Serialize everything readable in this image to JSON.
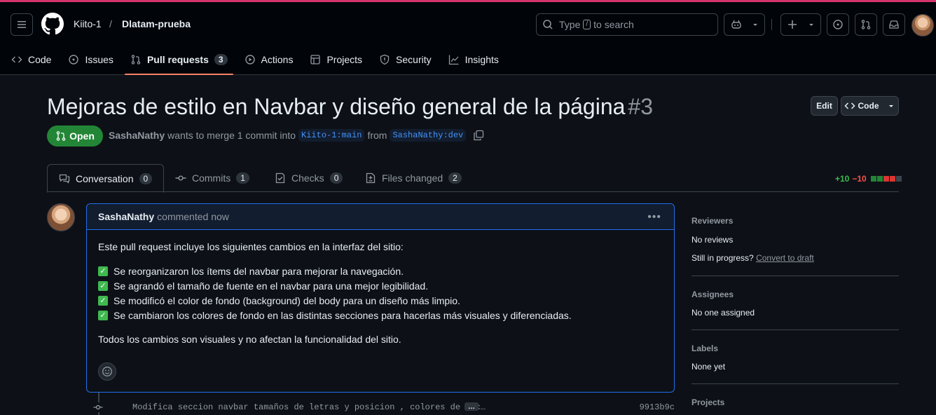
{
  "header": {
    "owner": "Kiito-1",
    "separator": "/",
    "repo": "Dlatam-prueba",
    "search": {
      "prefix": "Type",
      "key": "/",
      "suffix": "to search"
    }
  },
  "nav": {
    "items": [
      {
        "label": "Code",
        "icon": "code-icon"
      },
      {
        "label": "Issues",
        "icon": "issue-icon"
      },
      {
        "label": "Pull requests",
        "icon": "pull-request-icon",
        "count": "3",
        "active": true
      },
      {
        "label": "Actions",
        "icon": "play-icon"
      },
      {
        "label": "Projects",
        "icon": "table-icon"
      },
      {
        "label": "Security",
        "icon": "shield-icon"
      },
      {
        "label": "Insights",
        "icon": "graph-icon"
      }
    ]
  },
  "pr": {
    "title": "Mejoras de estilo en Navbar y diseño general de la página",
    "number": "#3",
    "edit_label": "Edit",
    "code_label": "Code",
    "state": "Open",
    "author": "SashaNathy",
    "merge_text": "wants to merge 1 commit into",
    "base_branch": "Kiito-1:main",
    "from_text": "from",
    "head_branch": "SashaNathy:dev"
  },
  "tabs": [
    {
      "label": "Conversation",
      "count": "0"
    },
    {
      "label": "Commits",
      "count": "1"
    },
    {
      "label": "Checks",
      "count": "0"
    },
    {
      "label": "Files changed",
      "count": "2"
    }
  ],
  "diffstat": {
    "additions": "+10",
    "deletions": "−10"
  },
  "comment": {
    "author": "SashaNathy",
    "action": "commented now",
    "intro": "Este pull request incluye los siguientes cambios en la interfaz del sitio:",
    "items": [
      "Se reorganizaron los ítems del navbar para mejorar la navegación.",
      "Se agrandó el tamaño de fuente en el navbar para una mejor legibilidad.",
      "Se modificó el color de fondo (background) del body para un diseño más limpio.",
      "Se cambiaron los colores de fondo en las distintas secciones para hacerlas más visuales y diferenciadas."
    ],
    "outro": "Todos los cambios son visuales y no afectan la funcionalidad del sitio."
  },
  "commit": {
    "message": "Modifica seccion navbar tamaños de letras y posicion , colores de bac…",
    "more": "…",
    "sha": "9913b9c"
  },
  "sidebar": {
    "reviewers_title": "Reviewers",
    "reviewers_value": "No reviews",
    "in_progress_text": "Still in progress?",
    "convert_link": "Convert to draft",
    "assignees_title": "Assignees",
    "assignees_value": "No one assigned",
    "labels_title": "Labels",
    "labels_value": "None yet",
    "projects_title": "Projects"
  },
  "colors": {
    "accent_underline": "#f78166",
    "open_green": "#238636",
    "addition": "#3fb950",
    "deletion": "#f85149",
    "comment_border": "#1f6feb"
  }
}
